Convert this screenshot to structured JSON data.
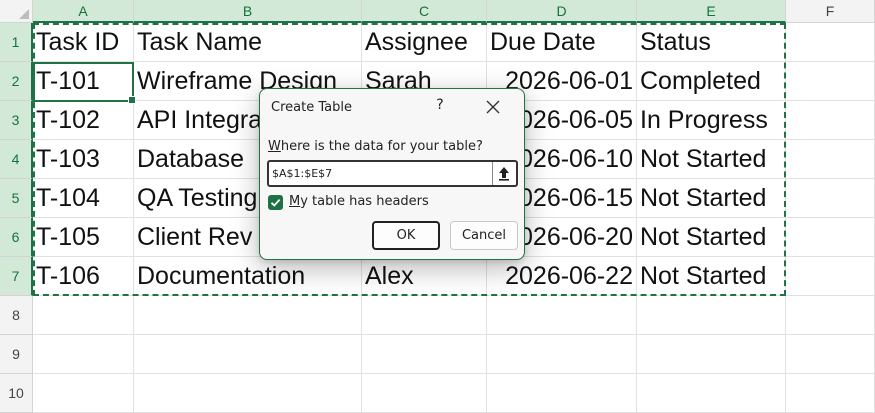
{
  "columns": [
    "A",
    "B",
    "C",
    "D",
    "E",
    "F"
  ],
  "rows": [
    "1",
    "2",
    "3",
    "4",
    "5",
    "6",
    "7",
    "8",
    "9",
    "10"
  ],
  "table": {
    "headers": [
      "Task ID",
      "Task Name",
      "Assignee",
      "Due Date",
      "Status"
    ],
    "rows": [
      [
        "T-101",
        "Wireframe Design",
        "Sarah",
        "2026-06-01",
        "Completed"
      ],
      [
        "T-102",
        "API Integration",
        "",
        "2026-06-05",
        "In Progress"
      ],
      [
        "T-103",
        "Database",
        "",
        "2026-06-10",
        "Not Started"
      ],
      [
        "T-104",
        "QA Testing",
        "",
        "2026-06-15",
        "Not Started"
      ],
      [
        "T-105",
        "Client Rev",
        "",
        "2026-06-20",
        "Not Started"
      ],
      [
        "T-106",
        "Documentation",
        "Alex",
        "2026-06-22",
        "Not Started"
      ]
    ]
  },
  "active_cell": "A2",
  "dialog": {
    "title": "Create Table",
    "help_label": "?",
    "prompt_prefix": "W",
    "prompt_rest": "here is the data for your table?",
    "range_value": "$A$1:$E$7",
    "checkbox_prefix": "M",
    "checkbox_rest": "y table has headers",
    "headers_checked": true,
    "ok_label": "OK",
    "cancel_label": "Cancel"
  },
  "colors": {
    "accent": "#217346",
    "header_selected_bg": "#d3e9d8"
  }
}
